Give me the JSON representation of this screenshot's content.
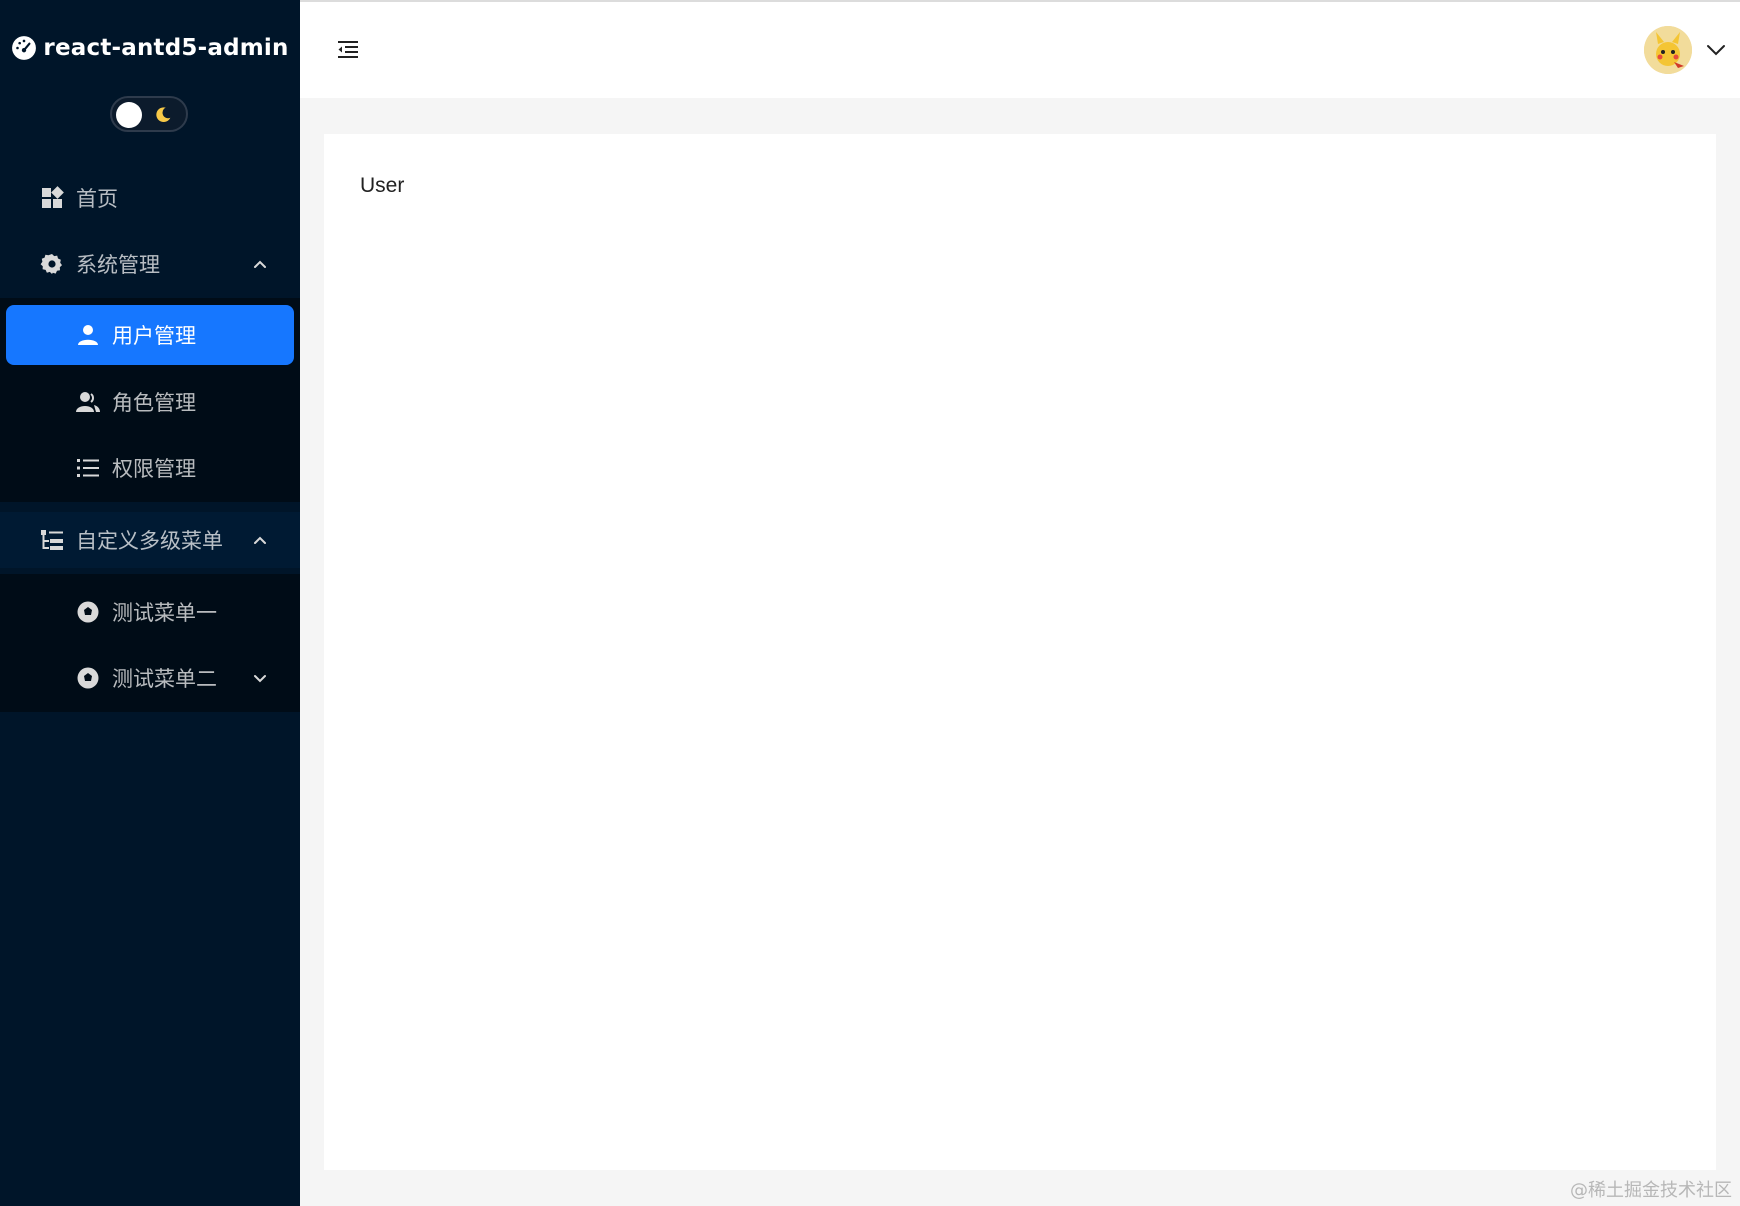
{
  "brand": {
    "title": "react-antd5-admin"
  },
  "menu": {
    "home": "首页",
    "system": {
      "label": "系统管理",
      "children": [
        "用户管理",
        "角色管理",
        "权限管理"
      ]
    },
    "custom": {
      "label": "自定义多级菜单",
      "children": [
        "测试菜单一",
        "测试菜单二"
      ]
    }
  },
  "content": {
    "text": "User"
  },
  "watermark": "@稀土掘金技术社区",
  "colors": {
    "sidebar_bg": "#001529",
    "submenu_bg": "#000c17",
    "primary": "#1677ff",
    "page_bg": "#f5f5f5"
  },
  "icons": {
    "brand": "dashboard-icon",
    "home": "appstore-icon",
    "system": "setting-icon",
    "users": "user-icon",
    "roles": "team-icon",
    "permissions": "unordered-list-icon",
    "custom": "tree-icon",
    "test1": "aperture-icon",
    "test2": "aperture-icon",
    "collapse": "menu-fold-icon",
    "user_menu": "chevron-down-icon"
  }
}
